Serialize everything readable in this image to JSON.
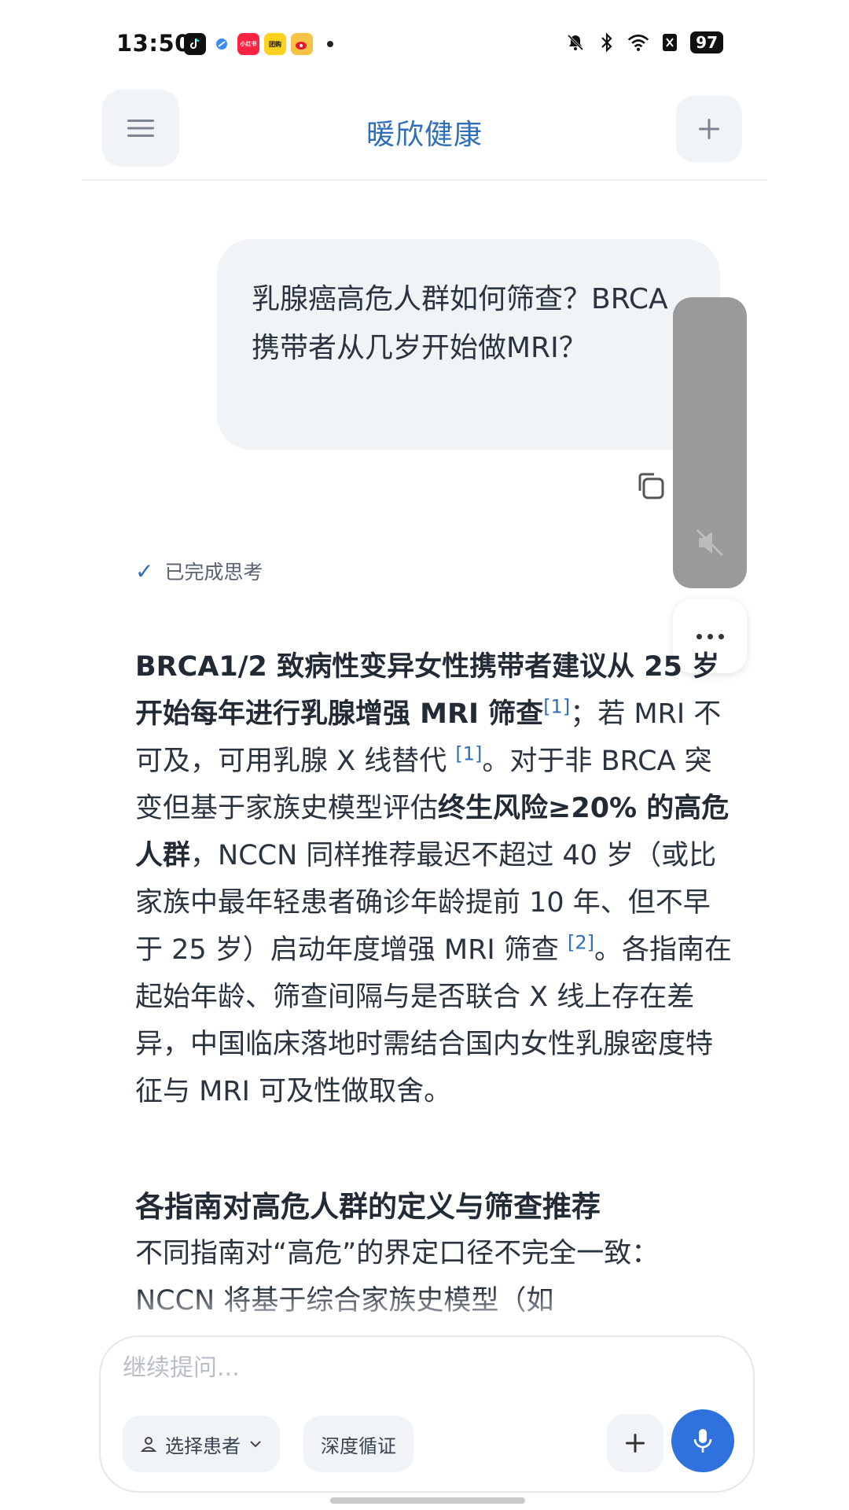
{
  "status_bar": {
    "time": "13:50",
    "battery": "97",
    "app_icons": [
      "tiktok-icon",
      "blue-app-icon",
      "xiaohongshu-icon",
      "yellow-app-icon",
      "weibo-icon"
    ],
    "xiaohongshu_label": "小红书",
    "yellow_app_label": "团购",
    "system_icons": [
      "mute-bell-icon",
      "bluetooth-icon",
      "wifi-icon",
      "sim-icon"
    ]
  },
  "header": {
    "title": "暖欣健康"
  },
  "user_message": {
    "text": "乳腺癌高危人群如何筛查？BRCA携带者从几岁开始做MRI？"
  },
  "thinking": {
    "label": "已完成思考"
  },
  "answer": {
    "p1_bold": "BRCA1/2 致病性变异女性携带者建议从 25 岁开始每年进行乳腺增强 MRI 筛查",
    "cite1": "[1]",
    "p1_text": "；若 MRI 不可及，可用乳腺 X 线替代 ",
    "cite2": "[1]",
    "p2_text": "。对于非 BRCA 突变但基于家族史模型评估",
    "p2_bold": "终生风险≥20% 的高危人群",
    "p3_text": "，NCCN 同样推荐最迟不超过 40 岁（或比家族中最年轻患者确诊年龄提前 10 年、但不早于 25 岁）启动年度增强 MRI 筛查 ",
    "cite3": "[2]",
    "p4_text": "。各指南在起始年龄、筛查间隔与是否联合 X 线上存在差异，中国临床落地时需结合国内女性乳腺密度特征与 MRI 可及性做取舍。",
    "section_title": "各指南对高危人群的定义与筛查推荐",
    "section_body": "不同指南对“高危”的界定口径不完全一致：NCCN 将基于综合家族史模型（如"
  },
  "composer": {
    "placeholder": "继续提问...",
    "patient_chip": "选择患者",
    "evidence_chip": "深度循证"
  },
  "colors": {
    "accent": "#2f6fba",
    "mic_button": "#2f72dd",
    "bubble_bg": "#f1f4f6"
  }
}
